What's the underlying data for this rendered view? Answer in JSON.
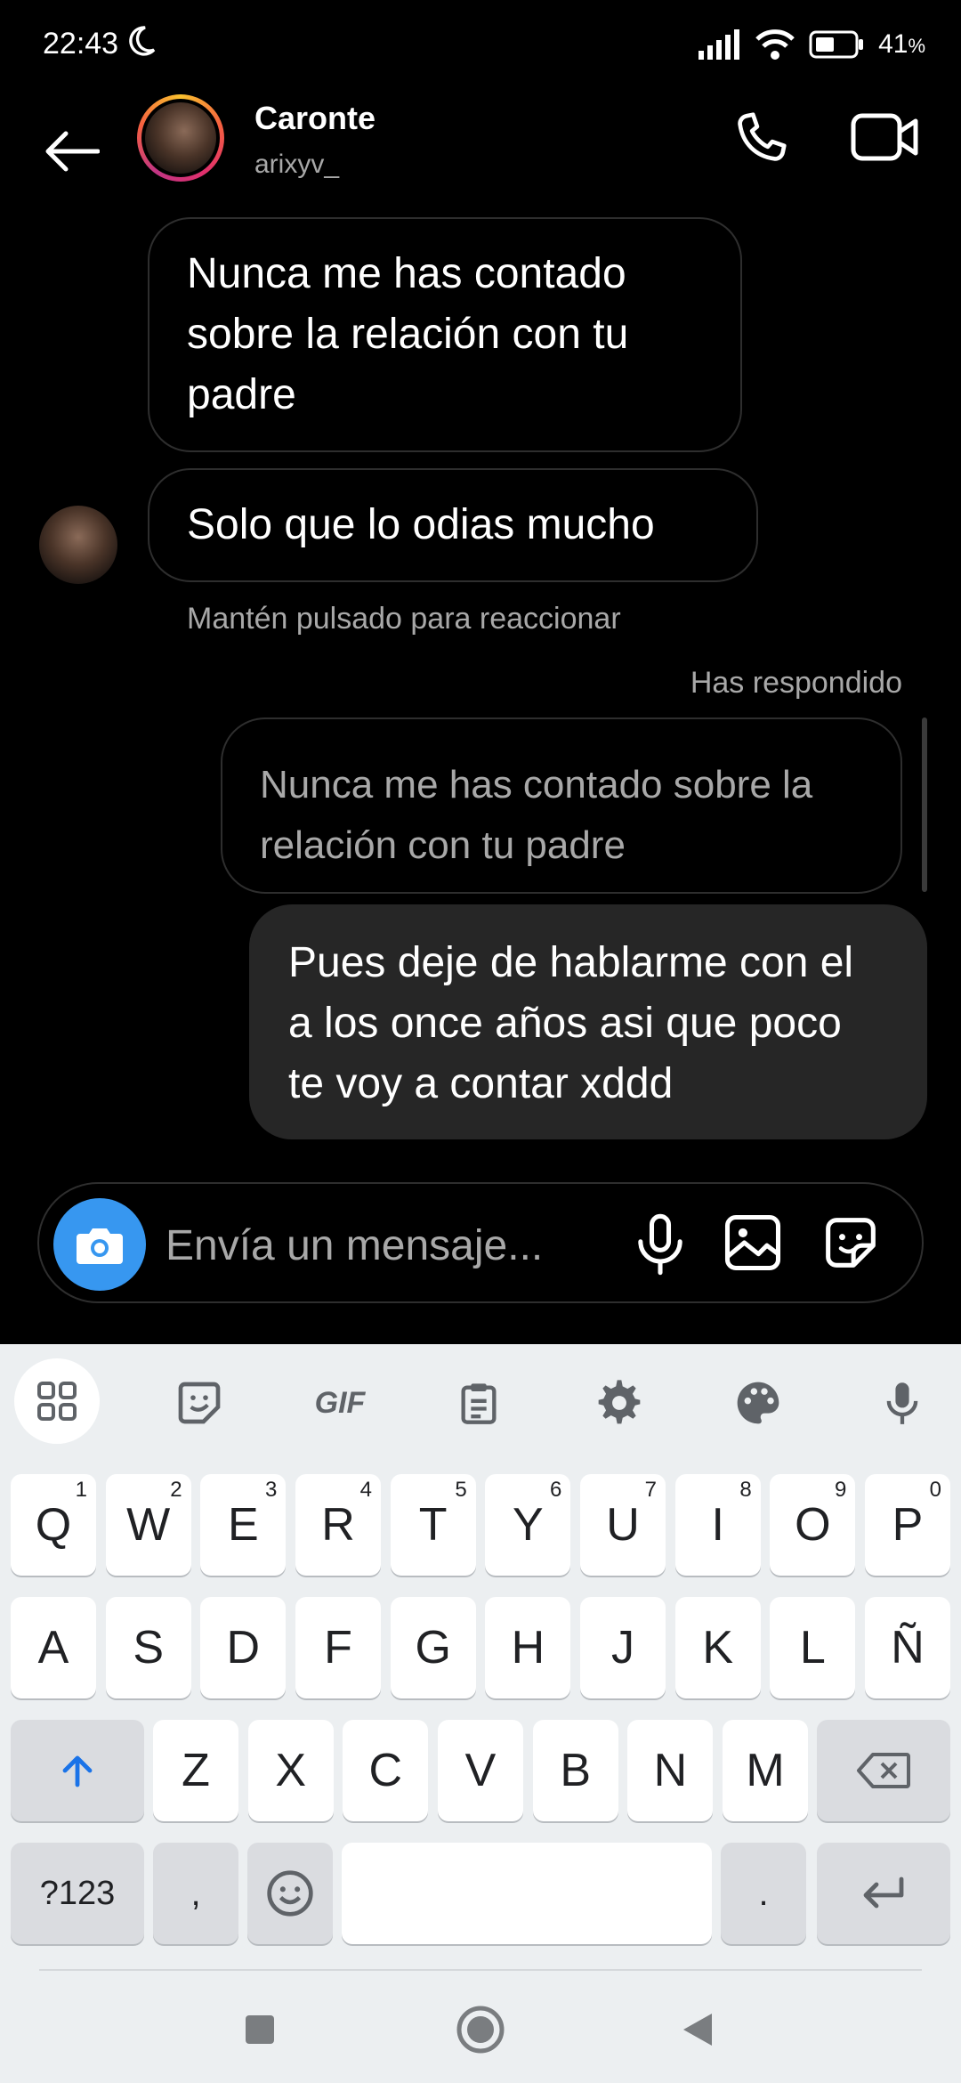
{
  "status_bar": {
    "time": "22:43",
    "battery": "41",
    "battery_unit": "%"
  },
  "header": {
    "name": "Caronte",
    "username": "arixyv_"
  },
  "messages": {
    "incoming_1": "Nunca me has contado sobre la relación con tu padre",
    "incoming_2": "Solo que lo odias mucho",
    "hint": "Mantén pulsado para reaccionar",
    "replied_label": "Has respondido",
    "quoted": "Nunca me has contado sobre la relación con tu padre",
    "outgoing": "Pues deje de hablarme con el a los once años asi que poco te voy a contar xddd"
  },
  "composer": {
    "placeholder": "Envía un mensaje..."
  },
  "keyboard": {
    "toolbar_gif": "GIF",
    "row1": [
      {
        "k": "Q",
        "n": "1"
      },
      {
        "k": "W",
        "n": "2"
      },
      {
        "k": "E",
        "n": "3"
      },
      {
        "k": "R",
        "n": "4"
      },
      {
        "k": "T",
        "n": "5"
      },
      {
        "k": "Y",
        "n": "6"
      },
      {
        "k": "U",
        "n": "7"
      },
      {
        "k": "I",
        "n": "8"
      },
      {
        "k": "O",
        "n": "9"
      },
      {
        "k": "P",
        "n": "0"
      }
    ],
    "row2": [
      "A",
      "S",
      "D",
      "F",
      "G",
      "H",
      "J",
      "K",
      "L",
      "Ñ"
    ],
    "row3": [
      "Z",
      "X",
      "C",
      "V",
      "B",
      "N",
      "M"
    ],
    "symbols_key": "?123",
    "comma_key": ",",
    "period_key": "."
  },
  "colors": {
    "accent": "#3797f0",
    "bubble_out": "#262626",
    "keyboard_bg": "#eceff1"
  }
}
